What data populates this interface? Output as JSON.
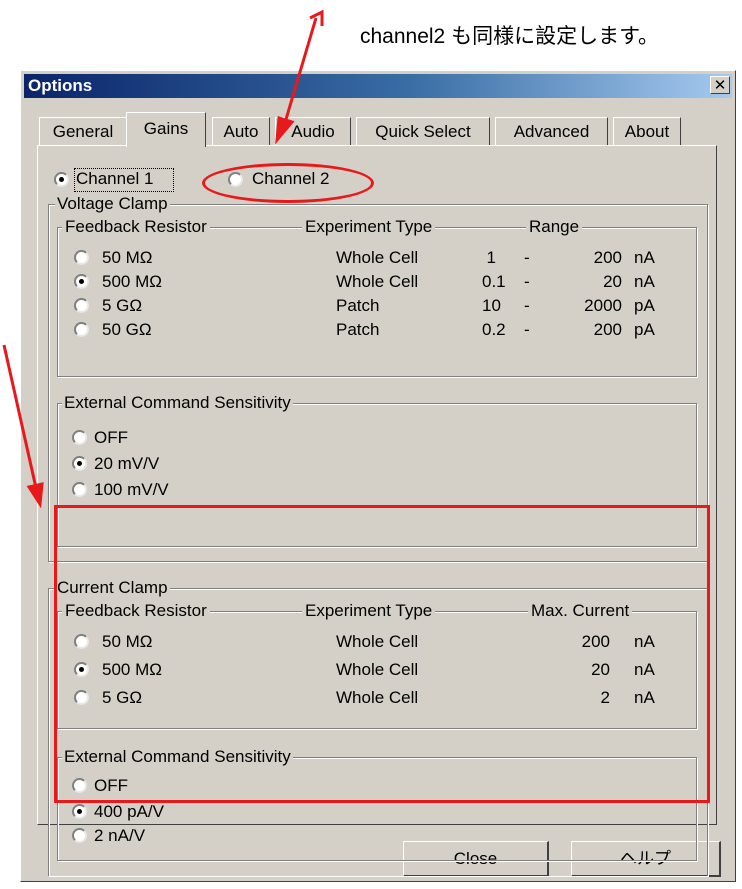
{
  "annotation": {
    "caption": "channel2 も同様に設定します。",
    "color": "#e8191b"
  },
  "window": {
    "title": "Options",
    "close_glyph": "✕"
  },
  "tabs": [
    {
      "label": "General",
      "active": false
    },
    {
      "label": "Gains",
      "active": true
    },
    {
      "label": "Auto",
      "active": false
    },
    {
      "label": "Audio",
      "active": false
    },
    {
      "label": "Quick Select",
      "active": false
    },
    {
      "label": "Advanced",
      "active": false
    },
    {
      "label": "About",
      "active": false
    }
  ],
  "channels": [
    {
      "label": "Channel 1",
      "selected": true
    },
    {
      "label": "Channel 2",
      "selected": false
    }
  ],
  "voltage_clamp": {
    "title": "Voltage Clamp",
    "feedback": {
      "headers": {
        "resistor": "Feedback Resistor",
        "type": "Experiment Type",
        "range": "Range"
      },
      "rows": [
        {
          "resistor": "50 MΩ",
          "type": "Whole Cell",
          "from": "1",
          "dash": "-",
          "to": "200",
          "unit": "nA",
          "selected": false
        },
        {
          "resistor": "500 MΩ",
          "type": "Whole Cell",
          "from": "0.1",
          "dash": "-",
          "to": "20",
          "unit": "nA",
          "selected": true
        },
        {
          "resistor": "5 GΩ",
          "type": "Patch",
          "from": "10",
          "dash": "-",
          "to": "2000",
          "unit": "pA",
          "selected": false
        },
        {
          "resistor": "50 GΩ",
          "type": "Patch",
          "from": "0.2",
          "dash": "-",
          "to": "200",
          "unit": "pA",
          "selected": false
        }
      ]
    },
    "ext_cmd": {
      "title": "External Command Sensitivity",
      "options": [
        {
          "label": "OFF",
          "selected": false
        },
        {
          "label": "20 mV/V",
          "selected": true
        },
        {
          "label": "100 mV/V",
          "selected": false
        }
      ]
    }
  },
  "current_clamp": {
    "title": "Current Clamp",
    "feedback": {
      "headers": {
        "resistor": "Feedback Resistor",
        "type": "Experiment Type",
        "max": "Max. Current"
      },
      "rows": [
        {
          "resistor": "50 MΩ",
          "type": "Whole Cell",
          "value": "200",
          "unit": "nA",
          "selected": false
        },
        {
          "resistor": "500 MΩ",
          "type": "Whole Cell",
          "value": "20",
          "unit": "nA",
          "selected": true
        },
        {
          "resistor": "5 GΩ",
          "type": "Whole Cell",
          "value": "2",
          "unit": "nA",
          "selected": false
        }
      ]
    },
    "ext_cmd": {
      "title": "External Command Sensitivity",
      "options": [
        {
          "label": "OFF",
          "selected": false
        },
        {
          "label": "400 pA/V",
          "selected": true
        },
        {
          "label": "2 nA/V",
          "selected": false
        }
      ]
    }
  },
  "buttons": {
    "close": "Close",
    "help": "ヘルプ"
  }
}
